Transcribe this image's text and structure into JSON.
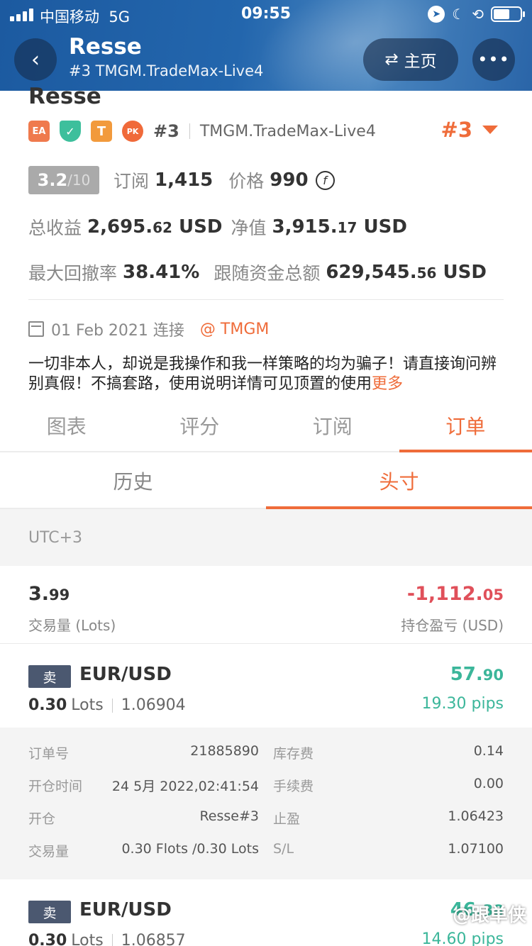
{
  "status_bar": {
    "carrier": "中国移动",
    "network": "5G",
    "time": "09:55"
  },
  "nav": {
    "title": "Resse",
    "subtitle": "#3 TMGM.TradeMax-Live4",
    "home_label": "主页",
    "back_icon": "chevron-left-icon",
    "more_icon": "ellipsis-icon"
  },
  "profile": {
    "name": "Resse",
    "badges": [
      "EA",
      "T",
      "PK"
    ],
    "rank": "#3",
    "server": "TMGM.TradeMax-Live4",
    "rank_big": "#3",
    "score": "3.2",
    "score_max": "/10",
    "subscribe_label": "订阅",
    "subscribe_count": "1,415",
    "price_label": "价格",
    "price_value": "990",
    "total_profit_label": "总收益",
    "total_profit_int": "2,695.",
    "total_profit_dec": "62",
    "total_profit_unit": "USD",
    "equity_label": "净值",
    "equity_int": "3,915.",
    "equity_dec": "17",
    "equity_unit": "USD",
    "drawdown_label": "最大回撤率",
    "drawdown_value": "38.41%",
    "follow_label": "跟随资金总额",
    "follow_int": "629,545.",
    "follow_dec": "56",
    "follow_unit": "USD",
    "connect_date": "01 Feb 2021 连接",
    "broker": "@ TMGM",
    "description": "一切非本人，却说是我操作和我一样策略的均为骗子！请直接询问辨别真假！不搞套路，使用说明详情可见顶置的使用",
    "more": "更多"
  },
  "tabs": [
    {
      "label": "图表",
      "active": false
    },
    {
      "label": "评分",
      "active": false
    },
    {
      "label": "订阅",
      "active": false
    },
    {
      "label": "订单",
      "active": true
    }
  ],
  "subtabs": [
    {
      "label": "历史",
      "active": false
    },
    {
      "label": "头寸",
      "active": true
    }
  ],
  "timezone": "UTC+3",
  "summary": {
    "volume_int": "3.",
    "volume_dec": "99",
    "volume_label": "交易量 (Lots)",
    "pl_int": "-1,112.",
    "pl_dec": "05",
    "pl_label": "持仓盈亏 (USD)"
  },
  "positions": [
    {
      "side": "卖",
      "symbol": "EUR/USD",
      "lots": "0.30",
      "lots_unit": "Lots",
      "open_price": "1.06904",
      "profit_int": "57.",
      "profit_dec": "90",
      "pips": "19.30 pips",
      "details": {
        "order_label": "订单号",
        "order_value": "21885890",
        "swap_label": "库存费",
        "swap_value": "0.14",
        "open_time_label": "开仓时间",
        "open_time_value": "24 5月 2022,02:41:54",
        "fee_label": "手续费",
        "fee_value": "0.00",
        "open_label": "开仓",
        "open_value": "Resse#3",
        "tp_label": "止盈",
        "tp_value": "1.06423",
        "volume_label": "交易量",
        "volume_value": "0.30 Flots /0.30 Lots",
        "sl_label": "S/L",
        "sl_value": "1.07100"
      }
    },
    {
      "side": "卖",
      "symbol": "EUR/USD",
      "lots": "0.30",
      "lots_unit": "Lots",
      "open_price": "1.06857",
      "profit_int": "46.",
      "profit_dec": "38",
      "pips": "14.60 pips"
    }
  ],
  "watermark": "@跟单侠",
  "colors": {
    "accent": "#ef6c3a",
    "loss": "#e0505a",
    "gain": "#3bb69a",
    "header": "#2366ad"
  }
}
